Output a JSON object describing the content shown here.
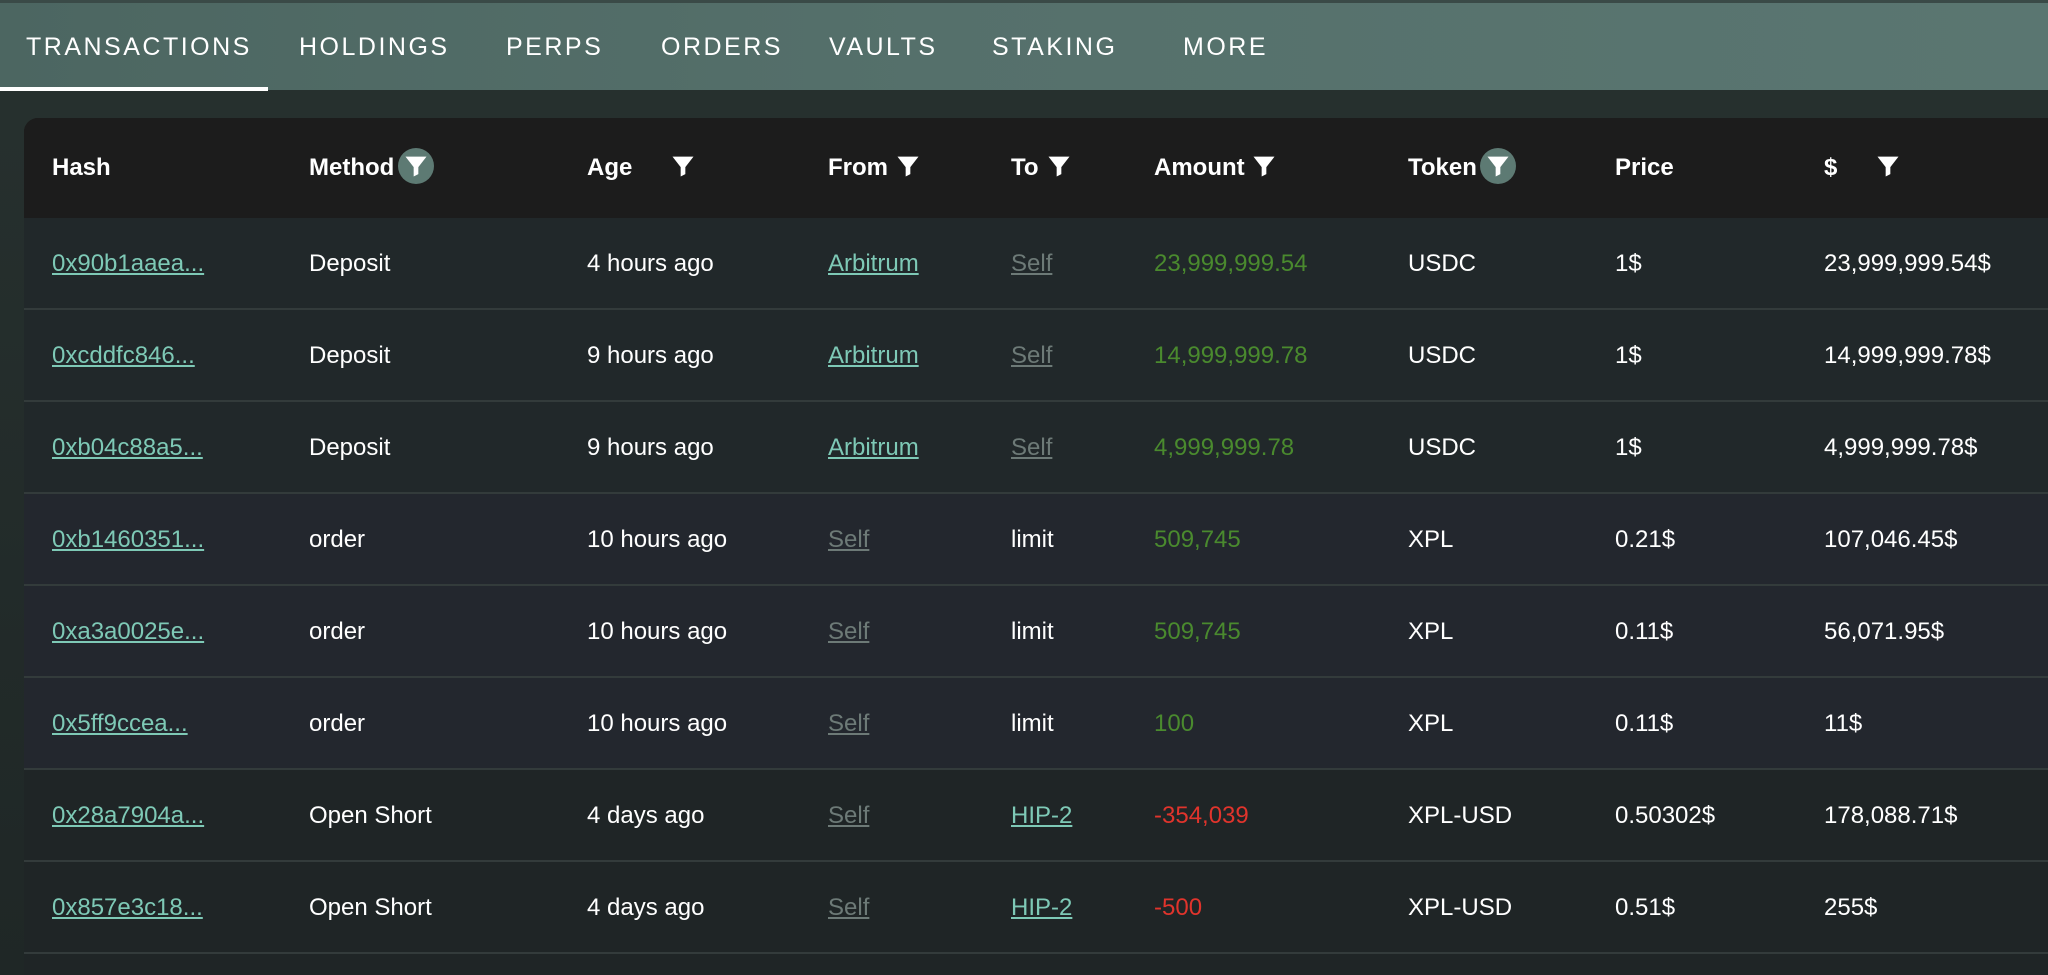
{
  "tabs": [
    "TRANSACTIONS",
    "HOLDINGS",
    "PERPS",
    "ORDERS",
    "VAULTS",
    "STAKING",
    "MORE"
  ],
  "columns": [
    "Hash",
    "Method",
    "Age",
    "From",
    "To",
    "Amount",
    "Token",
    "Price",
    "$"
  ],
  "rows": [
    {
      "hash": "0x90b1aaea...",
      "method": "Deposit",
      "age": "4 hours ago",
      "from": "Arbitrum",
      "to": "Self",
      "amount": "23,999,999.54",
      "token": "USDC",
      "price": "1$",
      "usd": "23,999,999.54$"
    },
    {
      "hash": "0xcddfc846...",
      "method": "Deposit",
      "age": "9 hours ago",
      "from": "Arbitrum",
      "to": "Self",
      "amount": "14,999,999.78",
      "token": "USDC",
      "price": "1$",
      "usd": "14,999,999.78$"
    },
    {
      "hash": "0xb04c88a5...",
      "method": "Deposit",
      "age": "9 hours ago",
      "from": "Arbitrum",
      "to": "Self",
      "amount": "4,999,999.78",
      "token": "USDC",
      "price": "1$",
      "usd": "4,999,999.78$"
    },
    {
      "hash": "0xb1460351...",
      "method": "order",
      "age": "10 hours ago",
      "from": "Self",
      "to": "limit",
      "amount": "509,745",
      "token": "XPL",
      "price": "0.21$",
      "usd": "107,046.45$"
    },
    {
      "hash": "0xa3a0025e...",
      "method": "order",
      "age": "10 hours ago",
      "from": "Self",
      "to": "limit",
      "amount": "509,745",
      "token": "XPL",
      "price": "0.11$",
      "usd": "56,071.95$"
    },
    {
      "hash": "0x5ff9ccea...",
      "method": "order",
      "age": "10 hours ago",
      "from": "Self",
      "to": "limit",
      "amount": "100",
      "token": "XPL",
      "price": "0.11$",
      "usd": "11$"
    },
    {
      "hash": "0x28a7904a...",
      "method": "Open Short",
      "age": "4 days ago",
      "from": "Self",
      "to": "HIP-2",
      "amount": "-354,039",
      "token": "XPL-USD",
      "price": "0.50302$",
      "usd": "178,088.71$"
    },
    {
      "hash": "0x857e3c18...",
      "method": "Open Short",
      "age": "4 days ago",
      "from": "Self",
      "to": "HIP-2",
      "amount": "-500",
      "token": "XPL-USD",
      "price": "0.51$",
      "usd": "255$"
    }
  ],
  "colors": {
    "accent_link": "#7ec9b6",
    "muted_link": "#6d7a77",
    "positive": "#4a8a2e",
    "negative": "#e0342c",
    "tab_bar": "#55706b",
    "filter_active": "#5d7a73"
  },
  "icons": {
    "filter": "filter-icon"
  }
}
